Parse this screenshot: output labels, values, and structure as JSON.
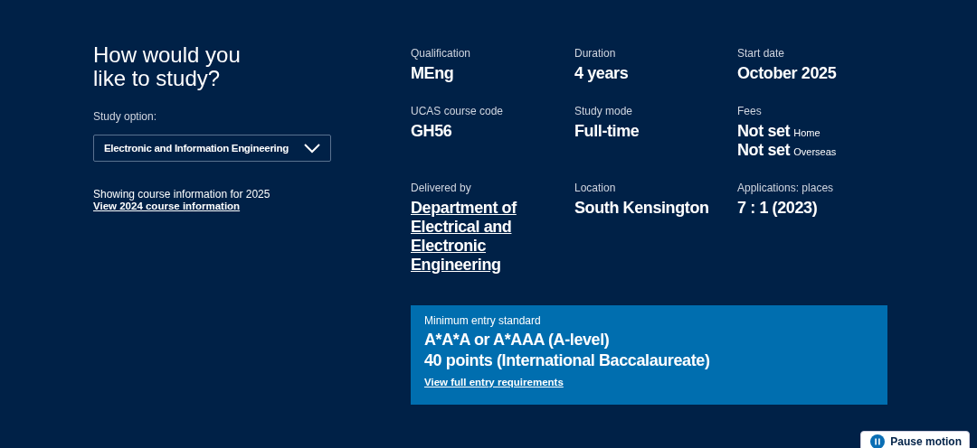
{
  "intro": {
    "heading": "How would you like to study?",
    "option_label": "Study option:",
    "option_value": "Electronic and Information Engineering",
    "showing": "Showing course information for 2025",
    "other_year_link": "View 2024 course information"
  },
  "facts": [
    {
      "label": "Qualification",
      "kind": "text",
      "value": "MEng"
    },
    {
      "label": "Duration",
      "kind": "text",
      "value": "4 years"
    },
    {
      "label": "Start date",
      "kind": "text",
      "value": "October 2025"
    },
    {
      "label": "UCAS course code",
      "kind": "text",
      "value": "GH56"
    },
    {
      "label": "Study mode",
      "kind": "text",
      "value": "Full-time"
    },
    {
      "label": "Fees",
      "kind": "fees",
      "lines": [
        {
          "value": "Not set",
          "note": "Home"
        },
        {
          "value": "Not set",
          "note": "Overseas"
        }
      ]
    },
    {
      "label": "Delivered by",
      "kind": "link",
      "value": "Department of Electrical and Electronic Engineering"
    },
    {
      "label": "Location",
      "kind": "text",
      "value": "South Kensington"
    },
    {
      "label": "Applications: places",
      "kind": "text",
      "value": "7 : 1 (2023)"
    }
  ],
  "entry": {
    "label": "Minimum entry standard",
    "lines": [
      "A*A*A or A*AAA (A-level)",
      "40 points (International Baccalaureate)"
    ],
    "link": "View full entry requirements"
  },
  "pause_button": "Pause motion"
}
